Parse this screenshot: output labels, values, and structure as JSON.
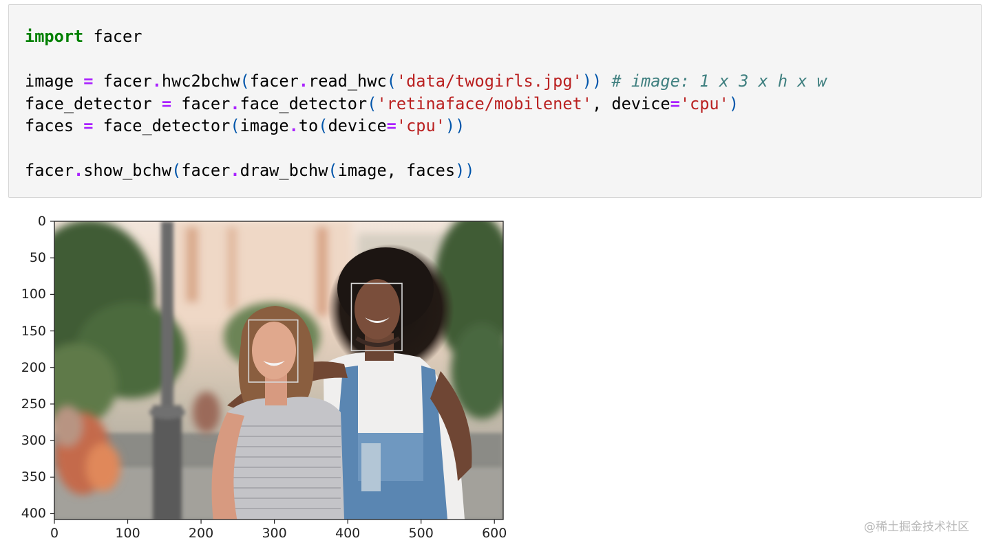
{
  "notebook": {
    "code_lines": [
      [
        "import",
        " facer"
      ],
      [],
      [
        "image ",
        "=",
        " facer",
        ".",
        "hwc2bchw",
        "(",
        "facer",
        ".",
        "read_hwc",
        "(",
        "'data/twogirls.jpg'",
        "))",
        " ",
        "# image: 1 x 3 x h x w"
      ],
      [
        "face_detector ",
        "=",
        " facer",
        ".",
        "face_detector",
        "(",
        "'retinaface/mobilenet'",
        ", device",
        "=",
        "'cpu'",
        ")"
      ],
      [
        "faces ",
        "=",
        " face_detector",
        "(",
        "image",
        ".",
        "to",
        "(",
        "device",
        "=",
        "'cpu'",
        "))"
      ],
      [],
      [
        "facer",
        ".",
        "show_bchw",
        "(",
        "facer",
        ".",
        "draw_bchw",
        "(",
        "image, faces",
        "))"
      ]
    ],
    "line1": {
      "kw": "import",
      "rest": " facer"
    },
    "line3": {
      "a": "image ",
      "eq": "=",
      "b": " facer",
      "dot1": ".",
      "c": "hwc2bchw",
      "p1": "(",
      "d": "facer",
      "dot2": ".",
      "e": "read_hwc",
      "p2": "(",
      "s": "'data/twogirls.jpg'",
      "p3": "))",
      "cm": "# image: 1 x 3 x h x w"
    },
    "line4": {
      "a": "face_detector ",
      "eq": "=",
      "b": " facer",
      "dot": ".",
      "c": "face_detector",
      "p1": "(",
      "s1": "'retinaface/mobilenet'",
      "mid": ", device",
      "eq2": "=",
      "s2": "'cpu'",
      "p2": ")"
    },
    "line5": {
      "a": "faces ",
      "eq": "=",
      "b": " face_detector",
      "p1": "(",
      "c": "image",
      "dot": ".",
      "d": "to",
      "p2": "(",
      "e": "device",
      "eq2": "=",
      "s": "'cpu'",
      "p3": "))"
    },
    "line7": {
      "a": "facer",
      "dot1": ".",
      "b": "show_bchw",
      "p1": "(",
      "c": "facer",
      "dot2": ".",
      "d": "draw_bchw",
      "p2": "(",
      "e": "image, faces",
      "p3": "))"
    }
  },
  "plot": {
    "y_ticks": [
      "0",
      "50",
      "100",
      "150",
      "200",
      "250",
      "300",
      "350",
      "400"
    ],
    "x_ticks": [
      "0",
      "100",
      "200",
      "300",
      "400",
      "500",
      "600"
    ],
    "y_tick_values": [
      0,
      50,
      100,
      150,
      200,
      250,
      300,
      350,
      400
    ],
    "x_tick_values": [
      0,
      100,
      200,
      300,
      400,
      500,
      600
    ],
    "image_extent": {
      "width": 612,
      "height": 408
    },
    "face_boxes": [
      {
        "x0": 265,
        "y0": 135,
        "x1": 332,
        "y1": 220
      },
      {
        "x0": 405,
        "y0": 85,
        "x1": 474,
        "y1": 177
      }
    ]
  },
  "colors": {
    "keyword": "#008000",
    "operator": "#aa22ff",
    "string": "#ba2121",
    "comment": "#408080",
    "paren": "#0055aa",
    "box": "#d8d8d8"
  },
  "watermark": "@稀土掘金技术社区"
}
